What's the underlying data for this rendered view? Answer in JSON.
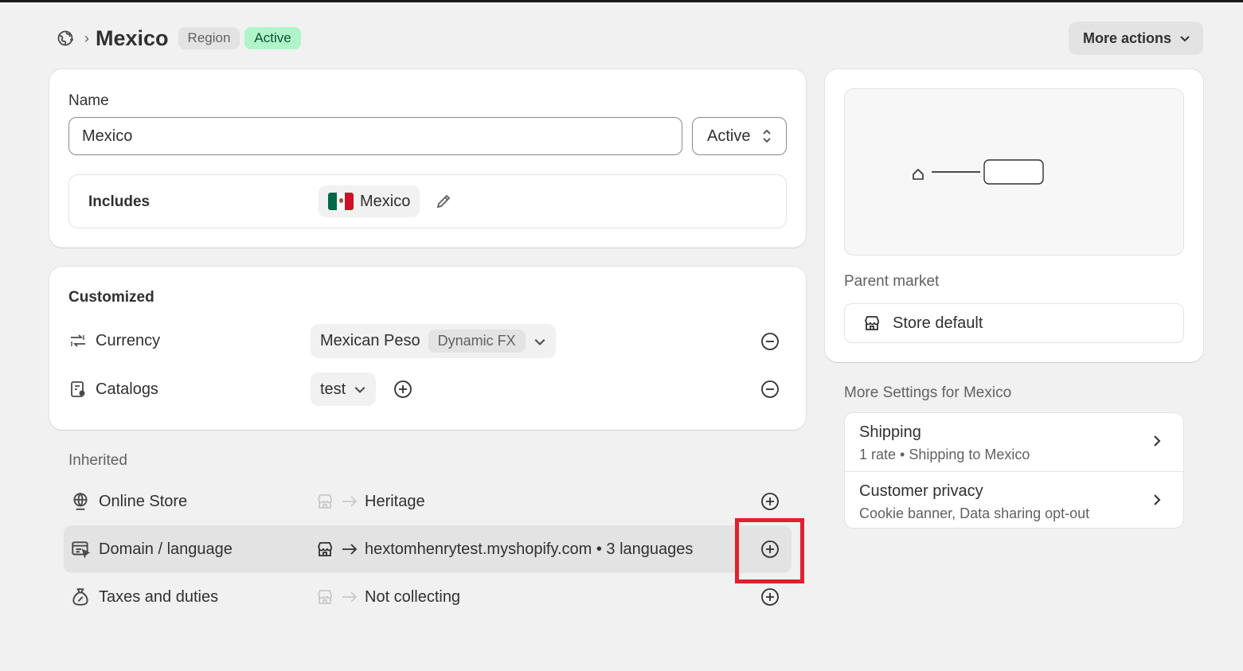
{
  "header": {
    "title": "Mexico",
    "badge_region": "Region",
    "badge_status": "Active",
    "more_actions": "More actions"
  },
  "name_card": {
    "name_label": "Name",
    "name_value": "Mexico",
    "status_value": "Active",
    "includes_label": "Includes",
    "included_country": "Mexico"
  },
  "customized": {
    "title": "Customized",
    "currency_label": "Currency",
    "currency_value": "Mexican Peso",
    "currency_badge": "Dynamic FX",
    "catalogs_label": "Catalogs",
    "catalogs_value": "test"
  },
  "inherited": {
    "title": "Inherited",
    "rows": [
      {
        "label": "Online Store",
        "value": "Heritage"
      },
      {
        "label": "Domain / language",
        "value": "hextomhenrytest.myshopify.com • 3 languages"
      },
      {
        "label": "Taxes and duties",
        "value": "Not collecting"
      }
    ]
  },
  "market_panel": {
    "parent_label": "Parent market",
    "parent_value": "Store default"
  },
  "more_settings": {
    "title": "More Settings for Mexico",
    "items": [
      {
        "title": "Shipping",
        "subtitle": "1 rate • Shipping to Mexico"
      },
      {
        "title": "Customer privacy",
        "subtitle": "Cookie banner, Data sharing opt-out"
      }
    ]
  },
  "colors": {
    "active_badge_bg": "#aff5c9",
    "active_badge_text": "#0c5132",
    "highlight": "#e0202e",
    "page_bg": "#f1f1f1"
  }
}
